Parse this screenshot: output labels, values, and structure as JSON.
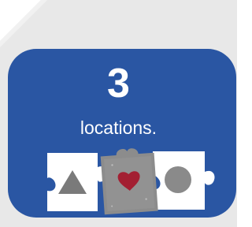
{
  "colors": {
    "page_background": "#e8e8e8",
    "card_background": "#2a56a3",
    "text": "#ffffff",
    "puzzle_white": "#ffffff",
    "puzzle_gray": "#8c8c8c",
    "triangle": "#7a7a7a",
    "heart": "#a31f32",
    "circle": "#8a8a8a"
  },
  "stat": {
    "number": "3",
    "label": "locations."
  },
  "puzzle": {
    "icons": [
      "triangle-icon",
      "heart-icon",
      "circle-icon"
    ]
  }
}
